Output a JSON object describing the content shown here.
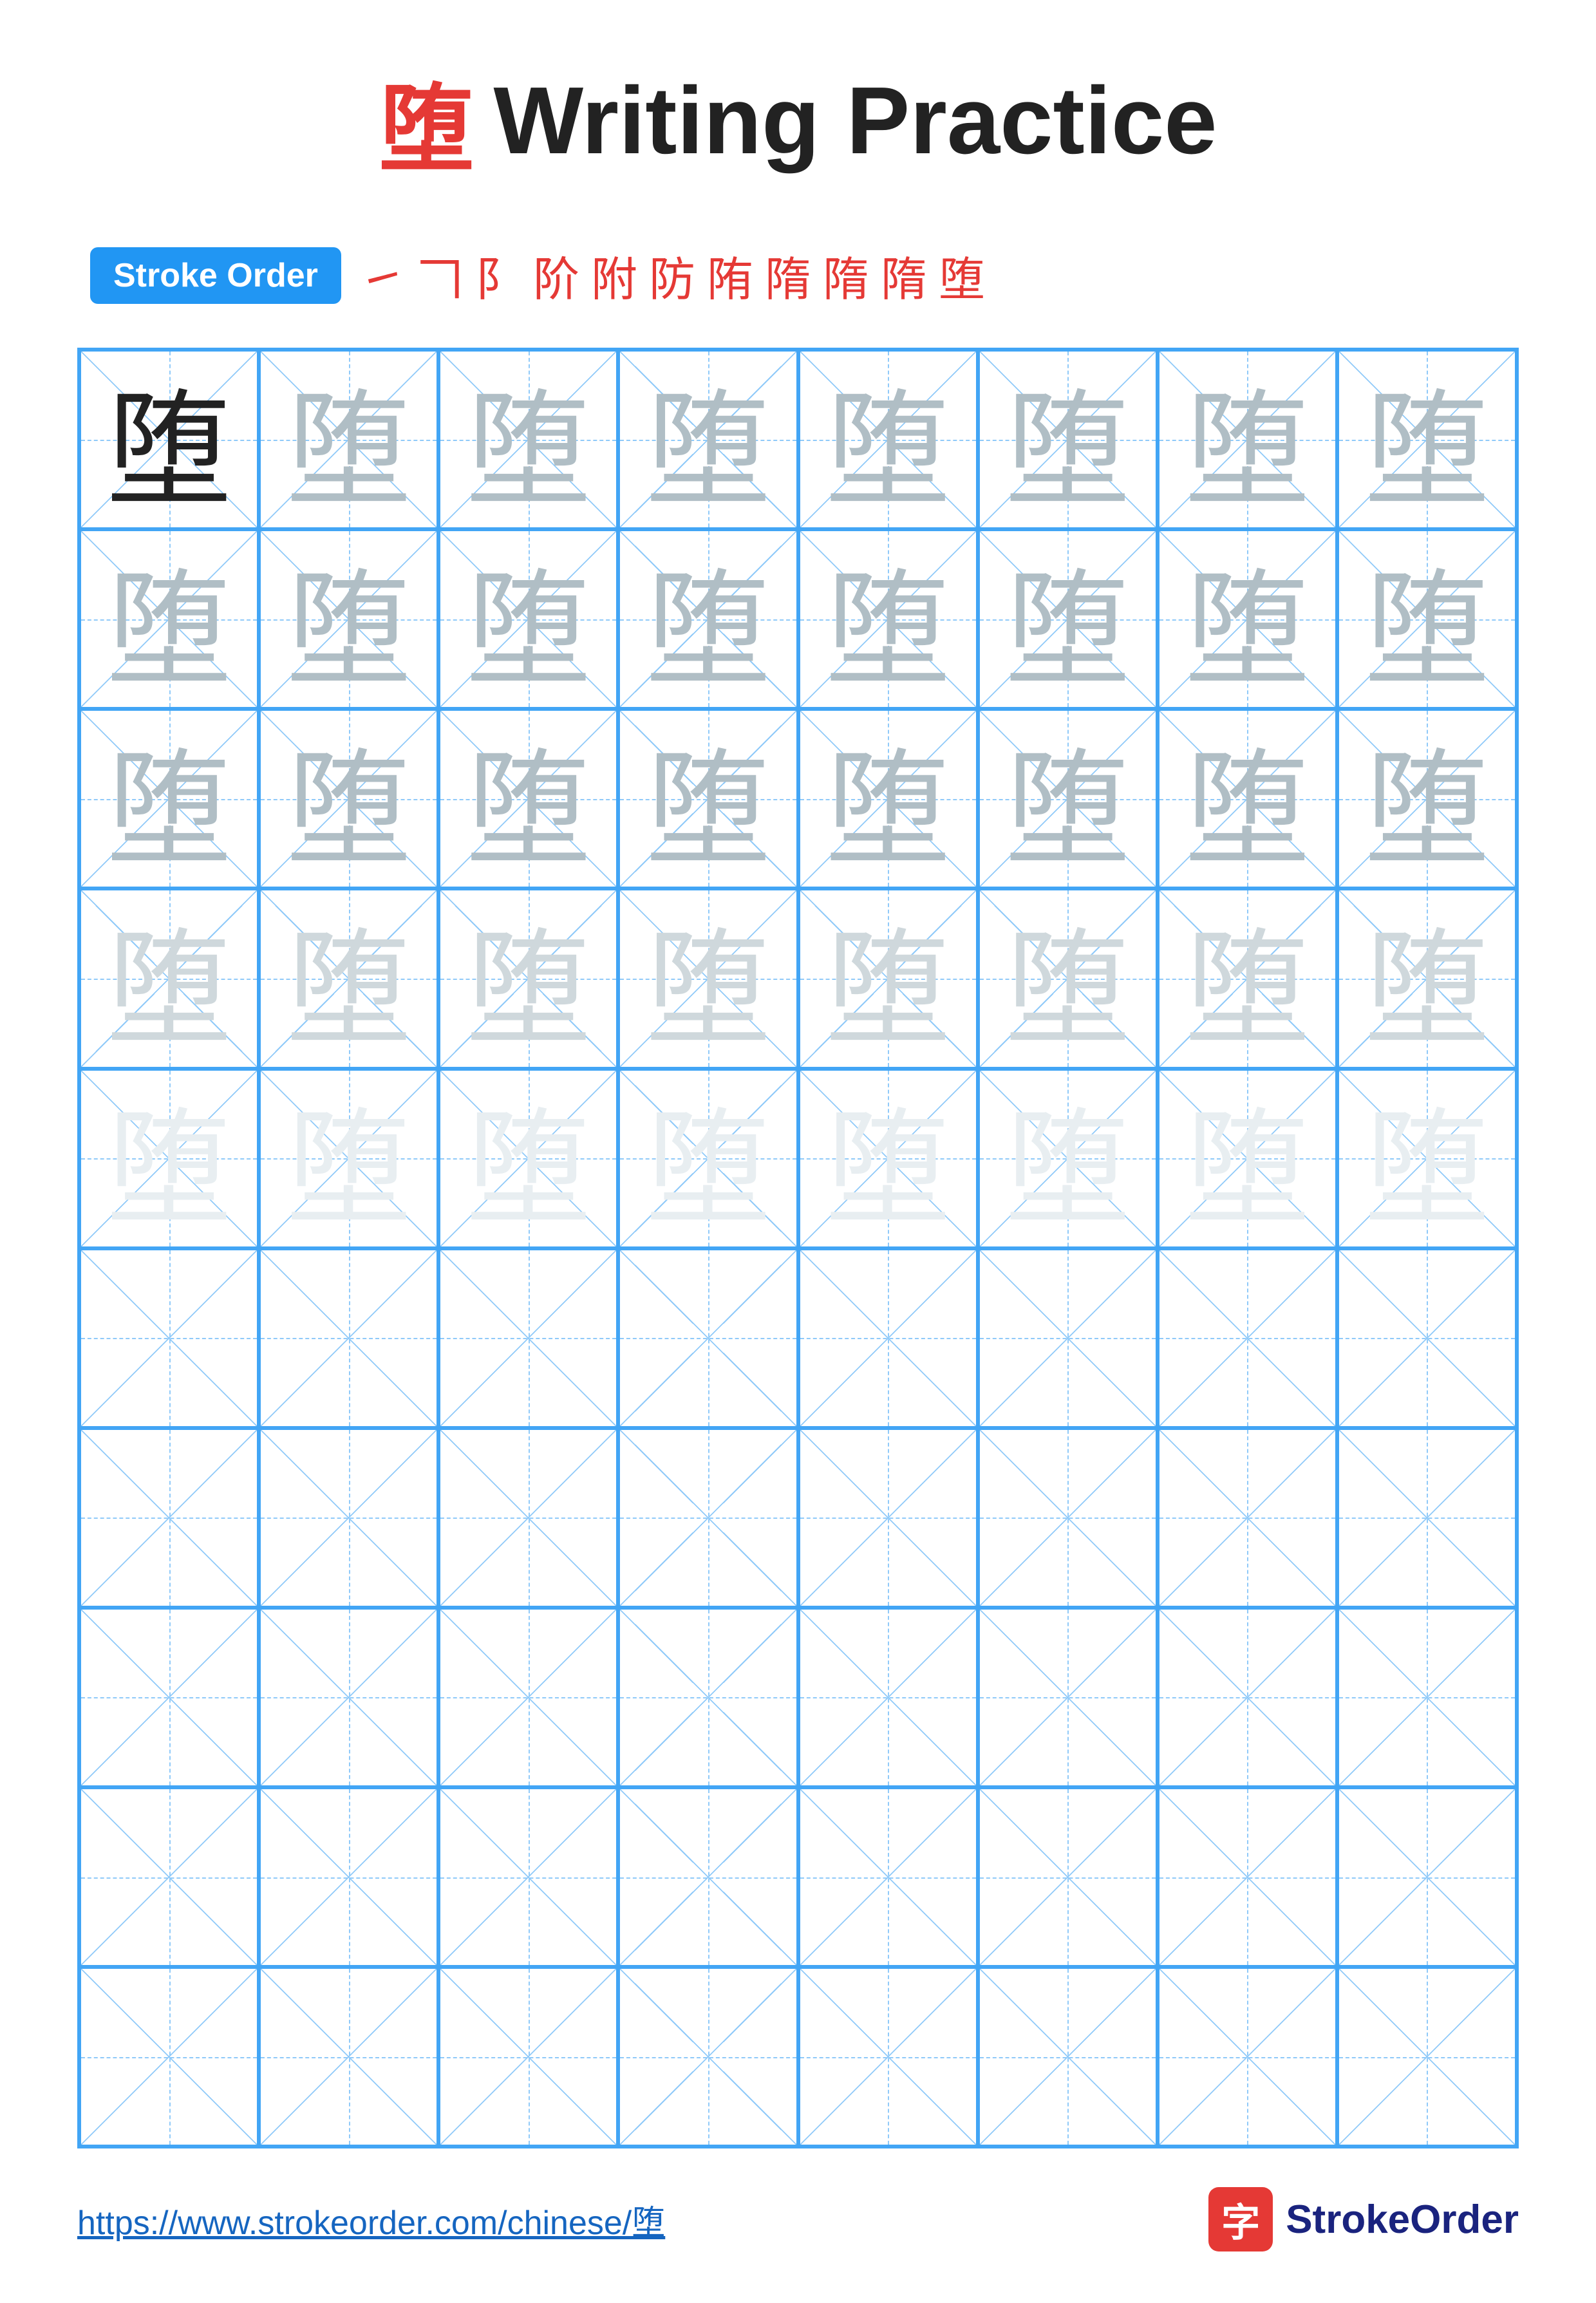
{
  "title": {
    "char": "堕",
    "label": "Writing Practice"
  },
  "stroke_order": {
    "badge_label": "Stroke Order",
    "steps": [
      "㇀",
      "𠃍",
      "⺃",
      "𠃋",
      "附",
      "防",
      "陏",
      "陏",
      "隋",
      "隋",
      "堕"
    ]
  },
  "grid": {
    "cols": 8,
    "rows": 10,
    "char": "堕",
    "practice_rows": [
      [
        "dark",
        "light1",
        "light1",
        "light1",
        "light1",
        "light1",
        "light1",
        "light1"
      ],
      [
        "light1",
        "light1",
        "light1",
        "light1",
        "light1",
        "light1",
        "light1",
        "light1"
      ],
      [
        "light1",
        "light1",
        "light1",
        "light1",
        "light1",
        "light1",
        "light1",
        "light1"
      ],
      [
        "lighter1",
        "lighter1",
        "lighter1",
        "lighter1",
        "lighter1",
        "lighter1",
        "lighter1",
        "lighter1"
      ],
      [
        "lightest",
        "lightest",
        "lightest",
        "lightest",
        "lightest",
        "lightest",
        "lightest",
        "lightest"
      ],
      [
        "empty",
        "empty",
        "empty",
        "empty",
        "empty",
        "empty",
        "empty",
        "empty"
      ],
      [
        "empty",
        "empty",
        "empty",
        "empty",
        "empty",
        "empty",
        "empty",
        "empty"
      ],
      [
        "empty",
        "empty",
        "empty",
        "empty",
        "empty",
        "empty",
        "empty",
        "empty"
      ],
      [
        "empty",
        "empty",
        "empty",
        "empty",
        "empty",
        "empty",
        "empty",
        "empty"
      ],
      [
        "empty",
        "empty",
        "empty",
        "empty",
        "empty",
        "empty",
        "empty",
        "empty"
      ]
    ]
  },
  "footer": {
    "url": "https://www.strokeorder.com/chinese/堕",
    "logo_char": "字",
    "logo_text": "StrokeOrder"
  }
}
